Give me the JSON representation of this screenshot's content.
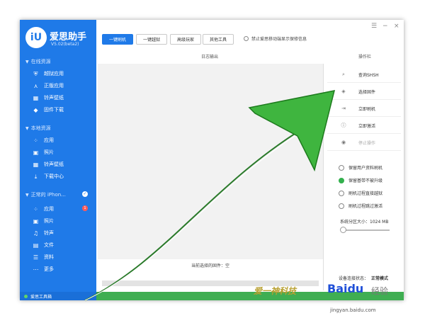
{
  "app": {
    "logo": "iU",
    "brand": "爱思助手",
    "version": "V5.02(beta2)"
  },
  "window_controls": {
    "menu": "☰",
    "minimize": "−",
    "close": "×"
  },
  "sidebar": {
    "online_title": "在线资源",
    "online_items": [
      {
        "label": "越狱应用",
        "icon": "shield-icon"
      },
      {
        "label": "正版应用",
        "icon": "app-store-icon"
      },
      {
        "label": "铃声壁纸",
        "icon": "film-icon"
      },
      {
        "label": "固件下载",
        "icon": "cube-icon"
      }
    ],
    "local_title": "本地资源",
    "local_items": [
      {
        "label": "应用",
        "icon": "grid-icon"
      },
      {
        "label": "照片",
        "icon": "image-icon"
      },
      {
        "label": "铃声壁纸",
        "icon": "film-icon"
      },
      {
        "label": "下载中心",
        "icon": "download-icon"
      }
    ],
    "device_title": "正常的 iPhon...",
    "device_items": [
      {
        "label": "应用",
        "icon": "grid-icon"
      },
      {
        "label": "照片",
        "icon": "image-icon"
      },
      {
        "label": "铃声",
        "icon": "music-icon"
      },
      {
        "label": "文件",
        "icon": "folder-icon"
      },
      {
        "label": "资料",
        "icon": "list-icon"
      },
      {
        "label": "更多",
        "icon": "more-icon"
      }
    ],
    "apps_badge": "1",
    "toolbox": "爱思工具箱"
  },
  "toolbar": {
    "buttons": [
      "一键刷机",
      "一键越狱",
      "高级玩家",
      "其他工具"
    ],
    "active_index": 0,
    "option": "禁止爱思移动端显示保修信息"
  },
  "panels": {
    "log_header": "日志输出",
    "ops_header": "操作栏",
    "firmware_label": "当前选择的固件：空",
    "progress": 0
  },
  "actions": [
    {
      "label": "查询SHSH",
      "icon": "search-icon"
    },
    {
      "label": "选择固件",
      "icon": "cube-icon"
    },
    {
      "label": "立即刷机",
      "icon": "flash-icon"
    },
    {
      "label": "立即激活",
      "icon": "info-icon"
    },
    {
      "label": "停止操作",
      "icon": "stop-icon"
    }
  ],
  "options": [
    {
      "label": "保留用户资料刷机",
      "checked": false
    },
    {
      "label": "保留基带不被升级",
      "checked": true
    },
    {
      "label": "刷机过程直接越狱",
      "checked": false
    },
    {
      "label": "刷机过程跳过激活",
      "checked": false
    }
  ],
  "system_partition": "系统分区大小：1024 MB",
  "mode": {
    "label": "设备连接状态：",
    "value": "正常模式"
  },
  "watermark": {
    "text": "爱一神科技",
    "brand": "Baidu",
    "brand2": "经验",
    "site": "jingyan.baidu.com"
  },
  "colors": {
    "accent": "#1f7ae8",
    "green": "#3fae52",
    "badge": "#ff5a5a"
  }
}
